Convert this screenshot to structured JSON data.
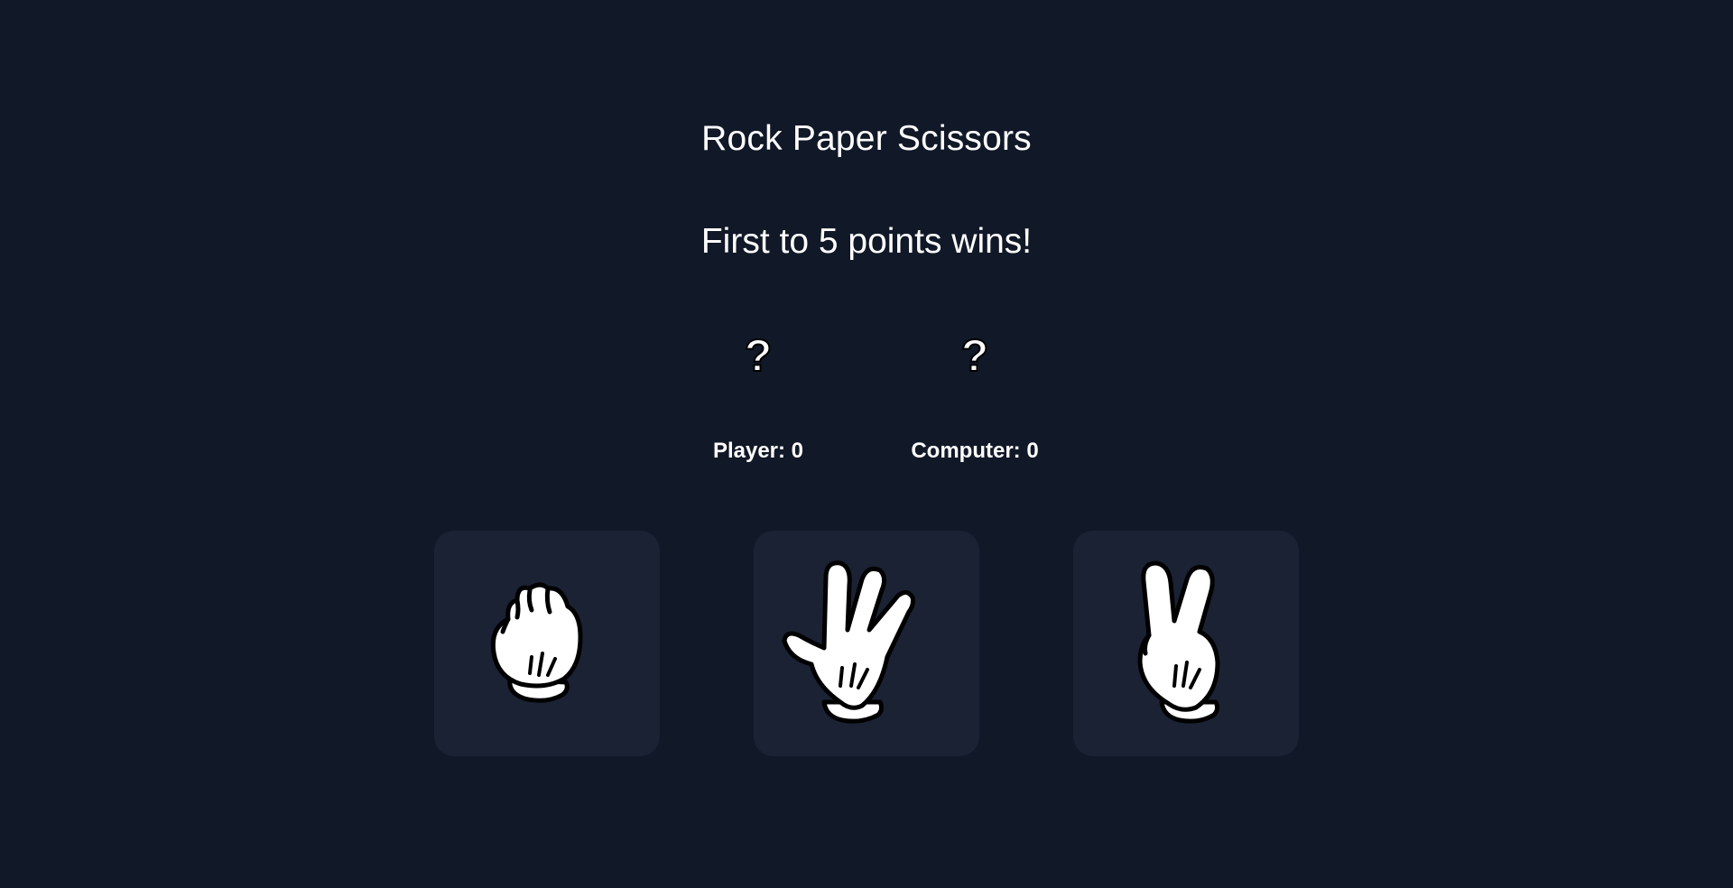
{
  "game": {
    "title": "Rock Paper Scissors",
    "message": "First to 5 points wins!",
    "player_choice": "?",
    "computer_choice": "?",
    "player_score_text": "Player: 0",
    "computer_score_text": "Computer: 0",
    "player_score": 0,
    "computer_score": 0,
    "target_points": 5
  },
  "choices": [
    {
      "name": "rock",
      "icon": "rock-hand-icon"
    },
    {
      "name": "paper",
      "icon": "paper-hand-icon"
    },
    {
      "name": "scissors",
      "icon": "scissors-hand-icon"
    }
  ],
  "colors": {
    "background": "#111827",
    "card": "#1a2233",
    "text": "#ffffff"
  }
}
